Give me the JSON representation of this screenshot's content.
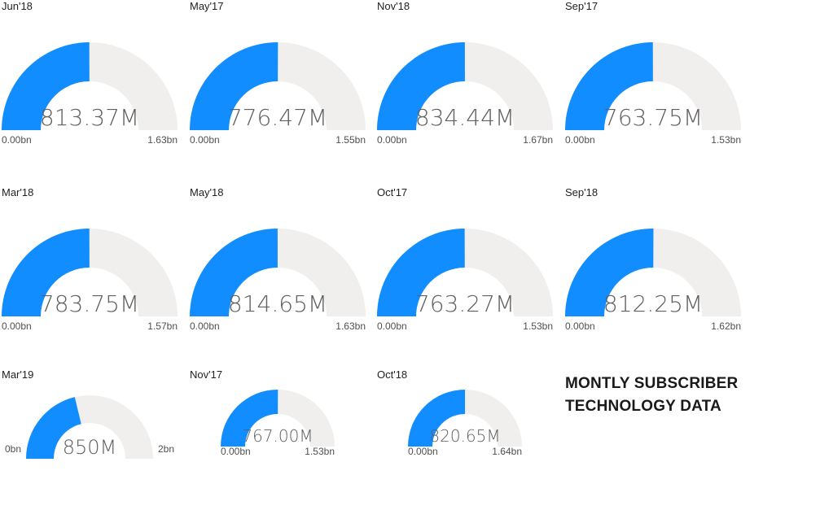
{
  "colors": {
    "fill": "#118DFF",
    "track": "#F0EFED",
    "value_text": "#606060",
    "label_text": "#222222"
  },
  "dashboard_title": {
    "line1": "MONTLY SUBSCRIBER",
    "line2": "TECHNOLOGY DATA"
  },
  "chart_data": [
    {
      "type": "gauge",
      "title": "Jun'18",
      "value": 813.37,
      "value_label": "813.37M",
      "min": 0,
      "max": 1630,
      "min_label": "0.00bn",
      "max_label": "1.63bn"
    },
    {
      "type": "gauge",
      "title": "May'17",
      "value": 776.47,
      "value_label": "776.47M",
      "min": 0,
      "max": 1550,
      "min_label": "0.00bn",
      "max_label": "1.55bn"
    },
    {
      "type": "gauge",
      "title": "Nov'18",
      "value": 834.44,
      "value_label": "834.44M",
      "min": 0,
      "max": 1670,
      "min_label": "0.00bn",
      "max_label": "1.67bn"
    },
    {
      "type": "gauge",
      "title": "Sep'17",
      "value": 763.75,
      "value_label": "763.75M",
      "min": 0,
      "max": 1530,
      "min_label": "0.00bn",
      "max_label": "1.53bn"
    },
    {
      "type": "gauge",
      "title": "Mar'18",
      "value": 783.75,
      "value_label": "783.75M",
      "min": 0,
      "max": 1570,
      "min_label": "0.00bn",
      "max_label": "1.57bn"
    },
    {
      "type": "gauge",
      "title": "May'18",
      "value": 814.65,
      "value_label": "814.65M",
      "min": 0,
      "max": 1630,
      "min_label": "0.00bn",
      "max_label": "1.63bn"
    },
    {
      "type": "gauge",
      "title": "Oct'17",
      "value": 763.27,
      "value_label": "763.27M",
      "min": 0,
      "max": 1530,
      "min_label": "0.00bn",
      "max_label": "1.53bn"
    },
    {
      "type": "gauge",
      "title": "Sep'18",
      "value": 812.25,
      "value_label": "812.25M",
      "min": 0,
      "max": 1620,
      "min_label": "0.00bn",
      "max_label": "1.62bn"
    },
    {
      "type": "gauge",
      "title": "Mar'19",
      "value": 850,
      "value_label": "850M",
      "min": 0,
      "max": 2000,
      "min_label": "0bn",
      "max_label": "2bn"
    },
    {
      "type": "gauge",
      "title": "Nov'17",
      "value": 767.0,
      "value_label": "767.00M",
      "min": 0,
      "max": 1530,
      "min_label": "0.00bn",
      "max_label": "1.53bn"
    },
    {
      "type": "gauge",
      "title": "Oct'18",
      "value": 820.65,
      "value_label": "820.65M",
      "min": 0,
      "max": 1640,
      "min_label": "0.00bn",
      "max_label": "1.64bn"
    }
  ]
}
